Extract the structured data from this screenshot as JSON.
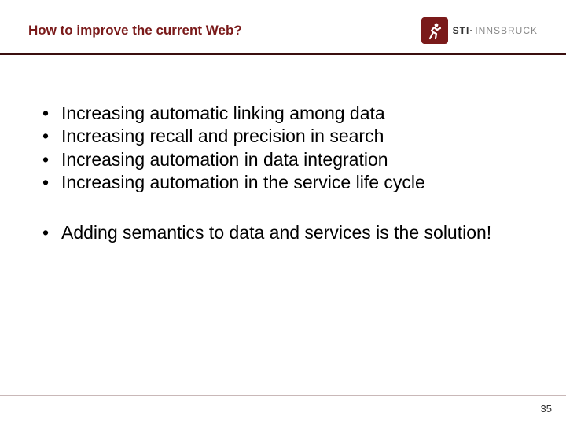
{
  "header": {
    "title": "How to improve the current Web?",
    "logo": {
      "brand_bold": "STI",
      "dot": "·",
      "brand_light": "INNSBRUCK"
    }
  },
  "bullets_group1": [
    "Increasing automatic linking among data",
    "Increasing recall and precision in search",
    "Increasing automation in data integration",
    "Increasing automation in the service life cycle"
  ],
  "bullets_group2": [
    "Adding semantics to data and services is the solution!"
  ],
  "page_number": "35"
}
